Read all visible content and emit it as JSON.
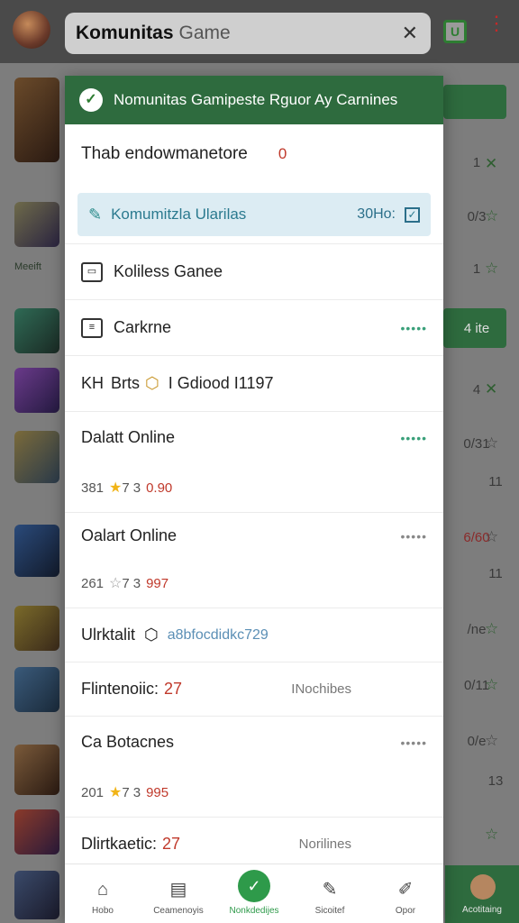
{
  "topbar": {
    "search_query": "Komunitas",
    "search_suffix": "Game"
  },
  "background": {
    "label": "Meeift",
    "rows": [
      {
        "right": "1",
        "t": 170
      },
      {
        "right": "0/3",
        "t": 230
      },
      {
        "right": "1",
        "t": 290
      },
      {
        "right": "4 ite",
        "t": 356
      },
      {
        "right": "4",
        "t": 424
      },
      {
        "right": "0/31",
        "t": 484
      },
      {
        "right": "11",
        "t": 526
      },
      {
        "right": "6/60",
        "t": 588
      },
      {
        "right": "11",
        "t": 628
      },
      {
        "right": "/ne",
        "t": 690
      },
      {
        "right": "0/11",
        "t": 752
      },
      {
        "right": "0/e",
        "t": 814
      },
      {
        "right": "13",
        "t": 858
      },
      {
        "right": "",
        "t": 918
      }
    ],
    "bottom_label": "Acotitaing"
  },
  "dialog": {
    "header_title": "Nomunitas Gamipeste Rguor Ay Carnines",
    "subtitle": "Thab endowmanetore",
    "subtitle_badge": "0",
    "highlight": {
      "text": "Komumitzla Ularilas",
      "right": "30Ho:"
    },
    "items": {
      "item1": "Koliless Ganee",
      "item2": "Carkrne",
      "item3_a": "KH",
      "item3_b": "Brts",
      "item3_c": "I Gdiood I1197",
      "item4": "Dalatt Online",
      "item4_stats": {
        "a": "381",
        "b": "7",
        "c": "3",
        "d": "0.90"
      },
      "item5": "Oalart Online",
      "item5_stats": {
        "a": "261",
        "b": "7",
        "c": "3",
        "d": "997"
      },
      "item6": "Ulrktalit",
      "item6_link": "a8bfocdidkc729",
      "item7": "Flintenoiic:",
      "item7_num": "27",
      "item7_mid": "INochibes",
      "item8": "Ca Botacnes",
      "item8_stats": {
        "a": "201",
        "b": "7",
        "c": "3",
        "d": "995"
      },
      "item9": "Dlirtkaetic:",
      "item9_num": "27",
      "item9_mid": "Norilines"
    },
    "tabs": [
      {
        "label": "Hobo",
        "icon": "home-icon"
      },
      {
        "label": "Ceamenoyis",
        "icon": "document-icon"
      },
      {
        "label": "Nonkdedijes",
        "icon": "check-icon"
      },
      {
        "label": "Sicoitef",
        "icon": "edit-icon"
      },
      {
        "label": "Opor",
        "icon": "edit-square-icon"
      }
    ]
  },
  "colors": {
    "header_green": "#2e6b3e",
    "accent_green": "#2e9a4a",
    "highlight_bg": "#dcecf3",
    "red": "#c0392b"
  }
}
